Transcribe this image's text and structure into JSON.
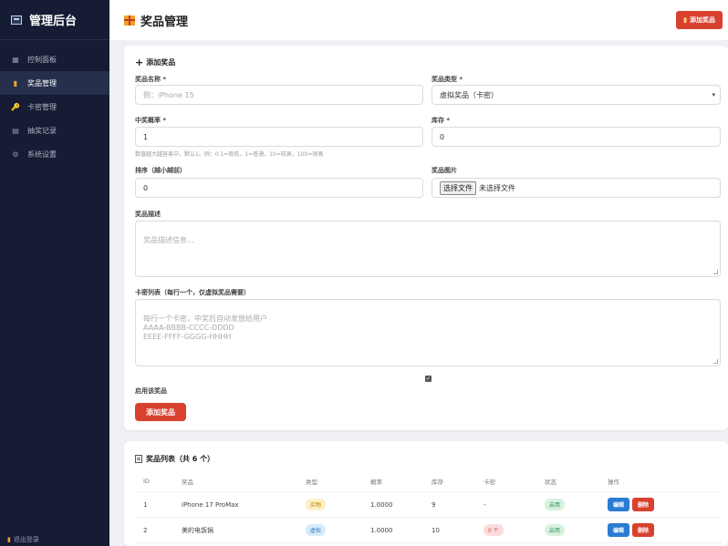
{
  "sidebar": {
    "title": "管理后台",
    "items": [
      {
        "label": "控制面板",
        "icon": "dashboard-icon",
        "glyph": "▦"
      },
      {
        "label": "奖品管理",
        "icon": "gift-icon",
        "glyph": "▮",
        "active": true
      },
      {
        "label": "卡密管理",
        "icon": "key-icon",
        "glyph": "🔑"
      },
      {
        "label": "抽奖记录",
        "icon": "clipboard-icon",
        "glyph": "▤"
      },
      {
        "label": "系统设置",
        "icon": "gear-icon",
        "glyph": "⚙"
      }
    ],
    "logout": "退出登录"
  },
  "header": {
    "title": "奖品管理",
    "add_button": "添加奖品"
  },
  "form": {
    "title": "添加奖品",
    "name_label": "奖品名称 *",
    "name_placeholder": "例：iPhone 15",
    "type_label": "奖品类型 *",
    "type_value": "虚拟奖品（卡密）",
    "prob_label": "中奖概率 *",
    "prob_value": "1",
    "prob_hint": "数值越大越容易中，默认1。例：0.1=极低，1=普通，10=较高，100=很高",
    "stock_label": "库存 *",
    "stock_value": "0",
    "sort_label": "排序（越小越前）",
    "sort_value": "0",
    "image_label": "奖品图片",
    "file_button": "选择文件",
    "file_status": "未选择文件",
    "desc_label": "奖品描述",
    "desc_placeholder": "奖品描述信息...",
    "cards_label": "卡密列表（每行一个，仅虚拟奖品需要）",
    "cards_placeholder": "每行一个卡密，中奖后自动发放给用户\nAAAA-BBBB-CCCC-DDDD\nEEEE-FFFF-GGGG-HHHH",
    "enable_label": "启用该奖品",
    "submit": "添加奖品"
  },
  "list": {
    "title": "奖品列表（共 6 个）",
    "columns": [
      "ID",
      "奖品",
      "类型",
      "概率",
      "库存",
      "卡密",
      "状态",
      "操作"
    ],
    "rows": [
      {
        "id": "1",
        "name": "iPhone 17 ProMax",
        "type": "实物",
        "prob": "1.0000",
        "stock": "9",
        "cards": "-",
        "status": "启用"
      },
      {
        "id": "2",
        "name": "美的电饭锅",
        "type": "虚拟",
        "prob": "1.0000",
        "stock": "10",
        "cards": "0 个",
        "status": "启用"
      }
    ],
    "edit_label": "编辑",
    "delete_label": "删除"
  },
  "colors": {
    "sidebar_bg": "#151c33",
    "accent_red": "#d9412f",
    "edit_blue": "#2b7bd3"
  }
}
